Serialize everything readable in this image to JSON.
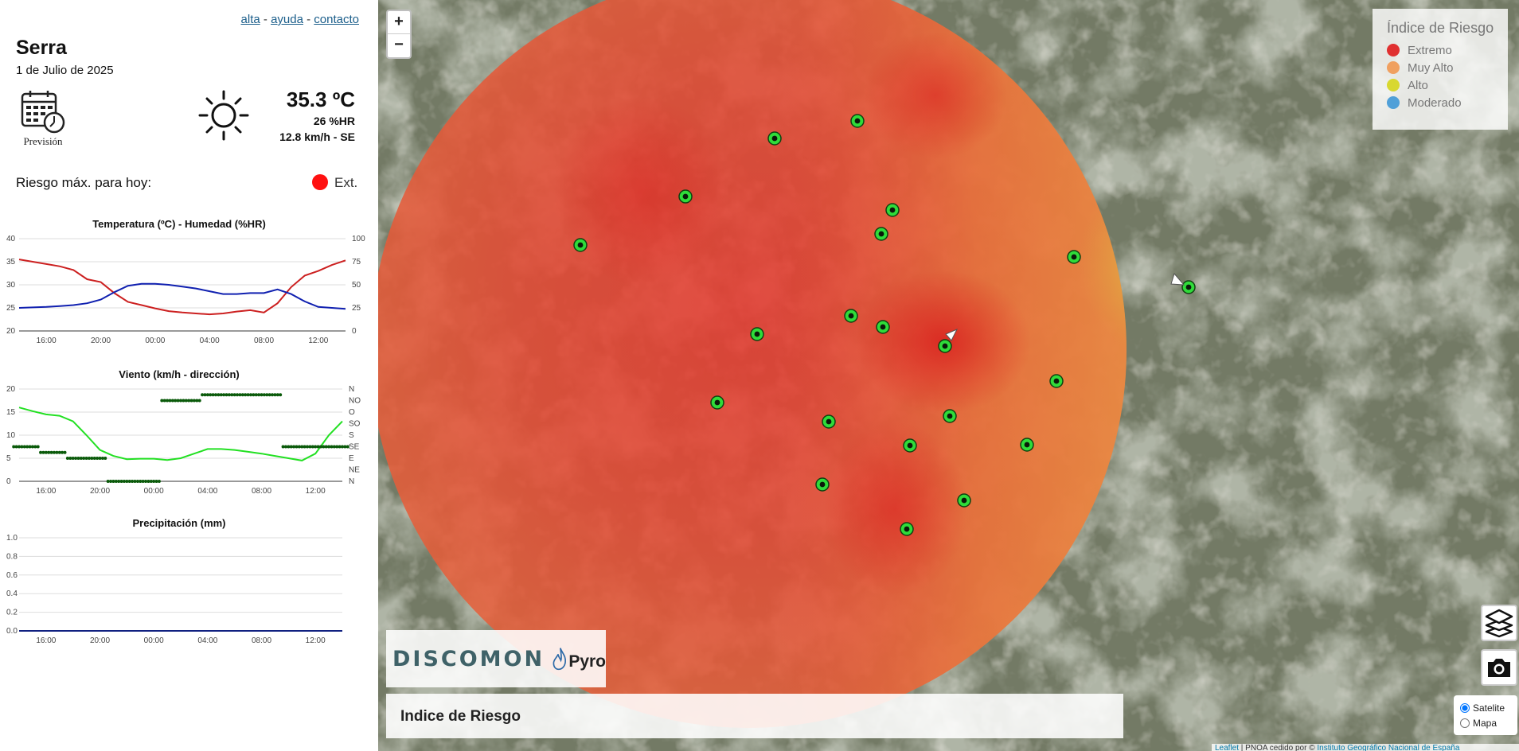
{
  "links": {
    "alta": "alta",
    "sep1": "-",
    "ayuda": "ayuda",
    "sep2": "-",
    "contacto": "contacto"
  },
  "location": {
    "name": "Serra",
    "date": "1 de Julio de 2025"
  },
  "forecast": {
    "label": "Previsión",
    "icon": "calendar-clock-icon"
  },
  "weather": {
    "icon": "sun-icon",
    "temperature": "35.3 ºC",
    "humidity": "26 %HR",
    "wind": "12.8 km/h - SE"
  },
  "risk": {
    "label": "Riesgo máx. para hoy:",
    "value": "Ext.",
    "color": "#ff1010"
  },
  "chart_data": [
    {
      "type": "line",
      "title": "Temperatura (ºC) - Humedad (%HR)",
      "x": [
        "14:00",
        "15:00",
        "16:00",
        "17:00",
        "18:00",
        "19:00",
        "20:00",
        "21:00",
        "22:00",
        "23:00",
        "00:00",
        "01:00",
        "02:00",
        "03:00",
        "04:00",
        "05:00",
        "06:00",
        "07:00",
        "08:00",
        "09:00",
        "10:00",
        "11:00",
        "12:00",
        "13:00",
        "14:00"
      ],
      "xticks": [
        "16:00",
        "20:00",
        "00:00",
        "04:00",
        "08:00",
        "12:00"
      ],
      "yticks_left": [
        "20",
        "25",
        "30",
        "35",
        "40"
      ],
      "yticks_right": [
        "0",
        "25",
        "50",
        "75",
        "100"
      ],
      "ylim_left": [
        20,
        40
      ],
      "ylim_right": [
        0,
        100
      ],
      "series": [
        {
          "axis": "left",
          "color": "#cc2020",
          "values": [
            35.5,
            35.0,
            34.5,
            34.0,
            33.2,
            31.2,
            30.6,
            28.2,
            26.3,
            25.6,
            24.9,
            24.3,
            24.0,
            23.8,
            23.6,
            23.8,
            24.2,
            24.5,
            24.0,
            26.0,
            29.5,
            32.0,
            33.0,
            34.3,
            35.3
          ]
        },
        {
          "axis": "right",
          "color": "#1020b0",
          "values": [
            25,
            25.5,
            26,
            27,
            28,
            30,
            34,
            42,
            49,
            51,
            51,
            50,
            48,
            46,
            43,
            40,
            40,
            41,
            41,
            45,
            40,
            32,
            26,
            25,
            24
          ]
        }
      ]
    },
    {
      "type": "line",
      "title": "Viento (km/h - dirección)",
      "x": [
        "14:00",
        "15:00",
        "16:00",
        "17:00",
        "18:00",
        "19:00",
        "20:00",
        "21:00",
        "22:00",
        "23:00",
        "00:00",
        "01:00",
        "02:00",
        "03:00",
        "04:00",
        "05:00",
        "06:00",
        "07:00",
        "08:00",
        "09:00",
        "10:00",
        "11:00",
        "12:00",
        "13:00",
        "14:00"
      ],
      "xticks": [
        "16:00",
        "20:00",
        "00:00",
        "04:00",
        "08:00",
        "12:00"
      ],
      "yticks_left": [
        "0",
        "5",
        "10",
        "15",
        "20"
      ],
      "yticks_right": [
        "N",
        "NE",
        "E",
        "SE",
        "S",
        "SO",
        "O",
        "NO",
        "N"
      ],
      "ylim_left": [
        0,
        20
      ],
      "series": [
        {
          "name": "speed",
          "color": "#22e022",
          "values": [
            16.0,
            15.2,
            14.5,
            14.2,
            13.0,
            10.0,
            6.8,
            5.5,
            4.8,
            4.9,
            4.9,
            4.6,
            5.0,
            6.0,
            7.0,
            7.0,
            6.8,
            6.4,
            6.0,
            5.5,
            5.0,
            4.5,
            6.0,
            10.0,
            13.0
          ]
        },
        {
          "name": "direction",
          "color": "#0a5a0a",
          "values": [
            3,
            3,
            2.5,
            2.5,
            2,
            2,
            2,
            0,
            0,
            0,
            0,
            7,
            7,
            7,
            7.5,
            7.5,
            7.5,
            7.5,
            7.5,
            7.5,
            3,
            3,
            3,
            3,
            3
          ]
        }
      ]
    },
    {
      "type": "line",
      "title": "Precipitación (mm)",
      "x": [
        "14:00",
        "15:00",
        "16:00",
        "17:00",
        "18:00",
        "19:00",
        "20:00",
        "21:00",
        "22:00",
        "23:00",
        "00:00",
        "01:00",
        "02:00",
        "03:00",
        "04:00",
        "05:00",
        "06:00",
        "07:00",
        "08:00",
        "09:00",
        "10:00",
        "11:00",
        "12:00",
        "13:00",
        "14:00"
      ],
      "xticks": [
        "16:00",
        "20:00",
        "00:00",
        "04:00",
        "08:00",
        "12:00"
      ],
      "yticks_left": [
        "0.0",
        "0.2",
        "0.4",
        "0.6",
        "0.8",
        "1.0"
      ],
      "ylim_left": [
        0,
        1
      ],
      "series": [
        {
          "name": "precip",
          "color": "#102080",
          "values": [
            0,
            0,
            0,
            0,
            0,
            0,
            0,
            0,
            0,
            0,
            0,
            0,
            0,
            0,
            0,
            0,
            0,
            0,
            0,
            0,
            0,
            0,
            0,
            0,
            0
          ]
        }
      ]
    }
  ],
  "map": {
    "zoom_in": "+",
    "zoom_out": "−",
    "legend": {
      "title": "Índice de Riesgo",
      "items": [
        {
          "label": "Extremo",
          "color": "#e03030"
        },
        {
          "label": "Muy Alto",
          "color": "#f0a060"
        },
        {
          "label": "Alto",
          "color": "#d8d830"
        },
        {
          "label": "Moderado",
          "color": "#50a0d8"
        }
      ]
    },
    "layer_title": "Indice de Riesgo",
    "brand": {
      "name": "DISCOMON",
      "product": "Pyro"
    },
    "base_layers": [
      {
        "label": "Satelite",
        "checked": true
      },
      {
        "label": "Mapa",
        "checked": false
      }
    ],
    "attribution": {
      "leaflet": "Leaflet",
      "text": " | PNOA cedido por © ",
      "ign": "Instituto Geográfico Nacional de España"
    },
    "sensors": [
      [
        602,
        152
      ],
      [
        498,
        174
      ],
      [
        386,
        247
      ],
      [
        254,
        308
      ],
      [
        646,
        264
      ],
      [
        632,
        294
      ],
      [
        874,
        323
      ],
      [
        1018,
        361
      ],
      [
        634,
        411
      ],
      [
        476,
        420
      ],
      [
        594,
        397
      ],
      [
        712,
        435
      ],
      [
        852,
        479
      ],
      [
        426,
        506
      ],
      [
        566,
        530
      ],
      [
        718,
        523
      ],
      [
        668,
        560
      ],
      [
        815,
        559
      ],
      [
        558,
        609
      ],
      [
        736,
        629
      ],
      [
        664,
        665
      ]
    ]
  }
}
